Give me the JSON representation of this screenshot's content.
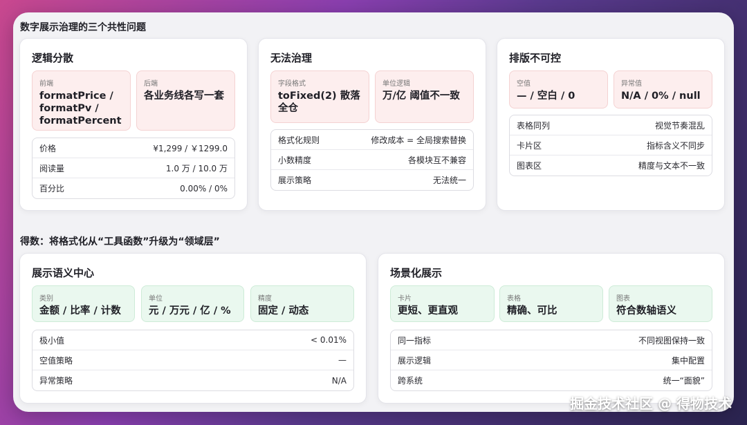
{
  "top_title": "数字展示治理的三个共性问题",
  "bottom_title": "得数：将格式化从“工具函数”升级为“领域层”",
  "cards": {
    "logic": {
      "title": "逻辑分散",
      "chips": [
        {
          "label": "前端",
          "value": "formatPrice / formatPv / formatPercent"
        },
        {
          "label": "后端",
          "value": "各业务线各写一套"
        }
      ],
      "rows": [
        {
          "k": "价格",
          "v": "¥1,299 / ￥1299.0"
        },
        {
          "k": "阅读量",
          "v": "1.0 万 / 10.0 万"
        },
        {
          "k": "百分比",
          "v": "0.00% / 0%"
        }
      ]
    },
    "ungoverned": {
      "title": "无法治理",
      "chips": [
        {
          "label": "字段格式",
          "value": "toFixed(2) 散落全仓"
        },
        {
          "label": "单位逻辑",
          "value": "万/亿 阈值不一致"
        }
      ],
      "rows": [
        {
          "k": "格式化规则",
          "v": "修改成本 = 全局搜索替换"
        },
        {
          "k": "小数精度",
          "v": "各模块互不兼容"
        },
        {
          "k": "展示策略",
          "v": "无法统一"
        }
      ]
    },
    "layout": {
      "title": "排版不可控",
      "chips": [
        {
          "label": "空值",
          "value": "— / 空白 / 0"
        },
        {
          "label": "异常值",
          "value": "N/A / 0% / null"
        }
      ],
      "rows": [
        {
          "k": "表格同列",
          "v": "视觉节奏混乱"
        },
        {
          "k": "卡片区",
          "v": "指标含义不同步"
        },
        {
          "k": "图表区",
          "v": "精度与文本不一致"
        }
      ]
    },
    "semantic": {
      "title": "展示语义中心",
      "chips": [
        {
          "label": "类别",
          "value": "金额 / 比率 / 计数"
        },
        {
          "label": "单位",
          "value": "元 / 万元 / 亿 / %"
        },
        {
          "label": "精度",
          "value": "固定 / 动态"
        }
      ],
      "rows": [
        {
          "k": "极小值",
          "v": "< 0.01%"
        },
        {
          "k": "空值策略",
          "v": "—"
        },
        {
          "k": "异常策略",
          "v": "N/A"
        }
      ]
    },
    "scene": {
      "title": "场景化展示",
      "chips": [
        {
          "label": "卡片",
          "value": "更短、更直观"
        },
        {
          "label": "表格",
          "value": "精确、可比"
        },
        {
          "label": "图表",
          "value": "符合数轴语义"
        }
      ],
      "rows": [
        {
          "k": "同一指标",
          "v": "不同视图保持一致"
        },
        {
          "k": "展示逻辑",
          "v": "集中配置"
        },
        {
          "k": "跨系统",
          "v": "统一“面貌”"
        }
      ]
    }
  },
  "watermark": "掘金技术社区 @ 得物技术",
  "colors": {
    "problem_chip": "#fdeeee",
    "solution_chip": "#eaf8ef"
  }
}
